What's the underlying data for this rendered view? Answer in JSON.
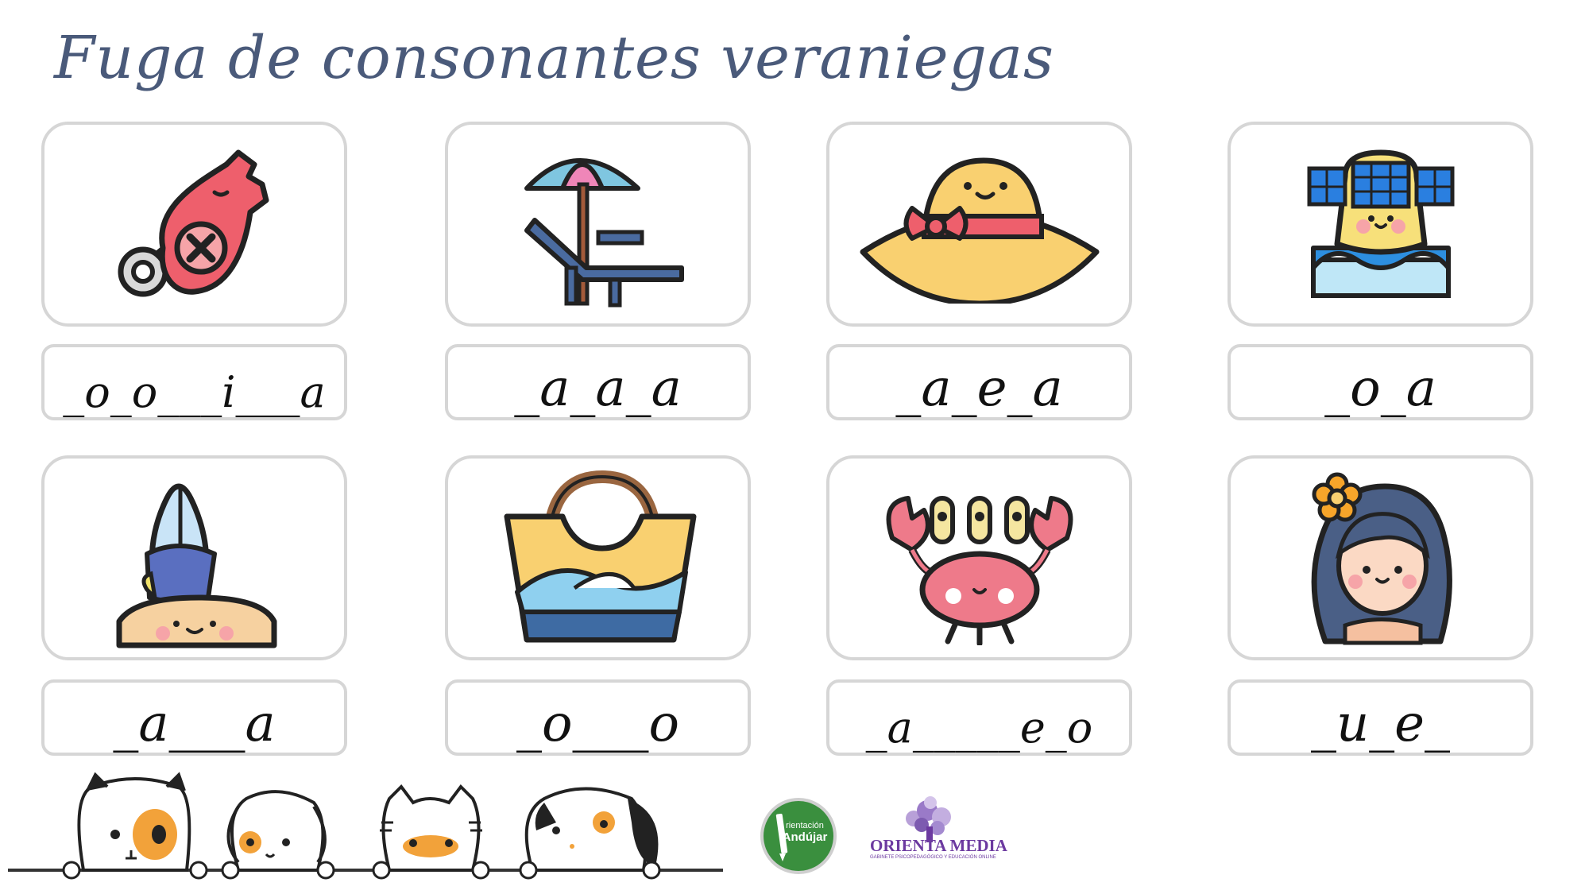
{
  "title": "Fuga de consonantes veraniegas",
  "cards": [
    {
      "icon": "whistle-icon",
      "word": "_o_o___i___a"
    },
    {
      "icon": "beach-umbrella-lounger-icon",
      "word": "_a_a_a"
    },
    {
      "icon": "sun-hat-icon",
      "word": "_a_e_a"
    },
    {
      "icon": "snorkel-mask-icon",
      "word": "_o_a"
    },
    {
      "icon": "surfboard-icon",
      "word": "_a___a"
    },
    {
      "icon": "beach-bag-icon",
      "word": "_o___o"
    },
    {
      "icon": "crab-icon",
      "word": "_a_____e_o"
    },
    {
      "icon": "girl-with-flower-icon",
      "word": "_u_e_"
    }
  ],
  "footer": {
    "animals": "cartoon-animals-illustration",
    "logo_orientacion_andujar": "Orientación Andújar",
    "logo_orientamedia": "ORIENTA MEDIA",
    "logo_orientamedia_sub": "GABINETE PSICOPEDAGÓGICO Y EDUCACIÓN ONLINE"
  },
  "colors": {
    "title": "#4a5a7a",
    "card_border": "#d6d6d6",
    "andujar_green": "#3a8f3e",
    "orientamedia_purple": "#6c3aa0"
  }
}
